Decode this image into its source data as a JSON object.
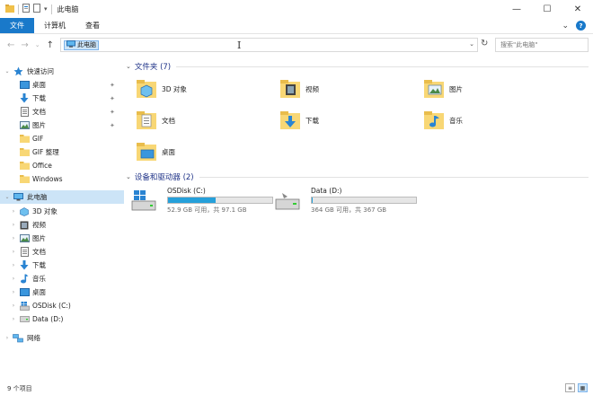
{
  "window": {
    "title": "此电脑",
    "qa_caret": "▾",
    "controls": {
      "minimize": "—",
      "maximize": "☐",
      "close": "✕"
    }
  },
  "ribbon": {
    "tabs": [
      "文件",
      "计算机",
      "查看"
    ],
    "expand_glyph": "⌄",
    "help_glyph": "?"
  },
  "nav": {
    "back": "←",
    "forward": "→",
    "recent": "⌄",
    "up": "↑"
  },
  "address": {
    "path": "此电脑",
    "dropdown_glyph": "⌄",
    "refresh_glyph": "↻",
    "search_placeholder": "搜索\"此电脑\"",
    "search_glyph": "⚲"
  },
  "sidebar": {
    "quick_access": "快速访问",
    "quick_items": [
      {
        "label": "桌面",
        "icon": "desktop-icon",
        "pinned": true
      },
      {
        "label": "下载",
        "icon": "download-icon",
        "pinned": true
      },
      {
        "label": "文档",
        "icon": "document-icon",
        "pinned": true
      },
      {
        "label": "图片",
        "icon": "picture-icon",
        "pinned": true
      },
      {
        "label": "GIF",
        "icon": "folder-icon",
        "pinned": false
      },
      {
        "label": "GIF 整理",
        "icon": "folder-icon",
        "pinned": false
      },
      {
        "label": "Office",
        "icon": "folder-icon",
        "pinned": false
      },
      {
        "label": "Windows",
        "icon": "folder-icon",
        "pinned": false
      }
    ],
    "pin_glyph": "✦",
    "this_pc": "此电脑",
    "pc_items": [
      {
        "label": "3D 对象",
        "icon": "3d-objects-icon"
      },
      {
        "label": "视频",
        "icon": "video-icon"
      },
      {
        "label": "图片",
        "icon": "picture-icon"
      },
      {
        "label": "文档",
        "icon": "document-icon"
      },
      {
        "label": "下载",
        "icon": "download-icon"
      },
      {
        "label": "音乐",
        "icon": "music-icon"
      },
      {
        "label": "桌面",
        "icon": "desktop-icon"
      },
      {
        "label": "OSDisk (C:)",
        "icon": "windows-drive-icon"
      },
      {
        "label": "Data (D:)",
        "icon": "drive-icon"
      }
    ],
    "network": "网络"
  },
  "content": {
    "folders_header": "文件夹 (7)",
    "folders": [
      {
        "label": "3D 对象",
        "icon": "3d-objects-icon"
      },
      {
        "label": "视频",
        "icon": "video-folder-icon"
      },
      {
        "label": "图片",
        "icon": "picture-folder-icon"
      },
      {
        "label": "文档",
        "icon": "document-folder-icon"
      },
      {
        "label": "下载",
        "icon": "download-folder-icon"
      },
      {
        "label": "音乐",
        "icon": "music-folder-icon"
      },
      {
        "label": "桌面",
        "icon": "desktop-folder-icon"
      }
    ],
    "devices_header": "设备和驱动器 (2)",
    "drives": [
      {
        "name": "OSDisk (C:)",
        "free": "52.9 GB 可用，共 97.1 GB",
        "used_fraction": 0.46
      },
      {
        "name": "Data (D:)",
        "free": "364 GB 可用，共 367 GB",
        "used_fraction": 0.01
      }
    ]
  },
  "status": {
    "count": "9 个项目"
  },
  "colors": {
    "accent": "#1979ca",
    "selection": "#cce4f7",
    "folder": "#f8d775",
    "drive_fill": "#26a0da"
  }
}
